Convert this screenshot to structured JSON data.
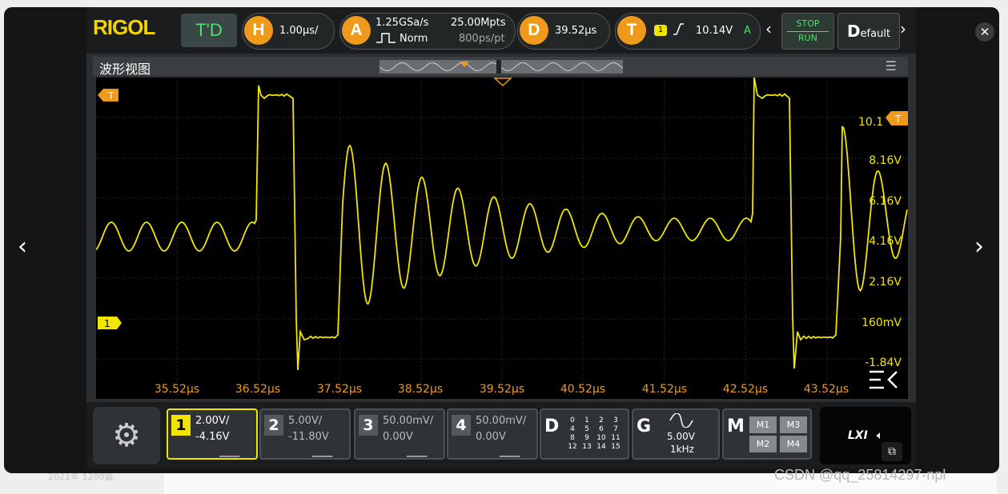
{
  "viewer": {
    "prev_arrow": "‹",
    "next_arrow": "›",
    "close": "✕",
    "watermark": "CSDN @qq_25814297-npl",
    "background_fragment": "2021年 1200篇"
  },
  "scope": {
    "brand": "RIGOL",
    "mode": "T'D",
    "horizontal": {
      "key": "H",
      "value": "1.00μs/"
    },
    "acquire": {
      "key": "A",
      "sample_rate": "1.25GSa/s",
      "mode": "Norm",
      "memory": "25.00Mpts",
      "resolution": "800ps/pt"
    },
    "delay": {
      "key": "D",
      "value": "39.52μs"
    },
    "trigger": {
      "key": "T",
      "channel": "1",
      "level": "10.14V",
      "status": "A"
    },
    "stop_label": "STOP",
    "run_label": "RUN",
    "default_label": "efault",
    "default_initial": "D",
    "waveform_title": "波形视图",
    "trigger_marker": "T",
    "trigger_level_marker": "10.1",
    "channel_marker": "1",
    "voltage_labels": [
      "8.16V",
      "6.16V",
      "4.16V",
      "2.16V",
      "160mV",
      "-1.84V"
    ],
    "time_labels": [
      "35.52μs",
      "36.52μs",
      "37.52μs",
      "38.52μs",
      "39.52μs",
      "40.52μs",
      "41.52μs",
      "42.52μs",
      "43.52μs"
    ],
    "channels": [
      {
        "num": "1",
        "scale": "2.00V/",
        "offset": "-4.16V"
      },
      {
        "num": "2",
        "scale": "5.00V/",
        "offset": "-11.80V"
      },
      {
        "num": "3",
        "scale": "50.00mV/",
        "offset": "0.00V"
      },
      {
        "num": "4",
        "scale": "50.00mV/",
        "offset": "0.00V"
      }
    ],
    "digital": {
      "key": "D",
      "bits": [
        "0",
        "1",
        "2",
        "3",
        "4",
        "5",
        "6",
        "7",
        "8",
        "9",
        "10",
        "11",
        "12",
        "13",
        "14",
        "15"
      ]
    },
    "generator": {
      "key": "G",
      "amplitude": "5.00V",
      "frequency": "1kHz"
    },
    "math": {
      "key": "M",
      "items": [
        "M1",
        "M3",
        "M2",
        "M4"
      ]
    },
    "lxi": "LXI",
    "colors": {
      "ch1": "#f2e600",
      "accent": "#f09a1c",
      "run": "#4ee06b"
    }
  }
}
